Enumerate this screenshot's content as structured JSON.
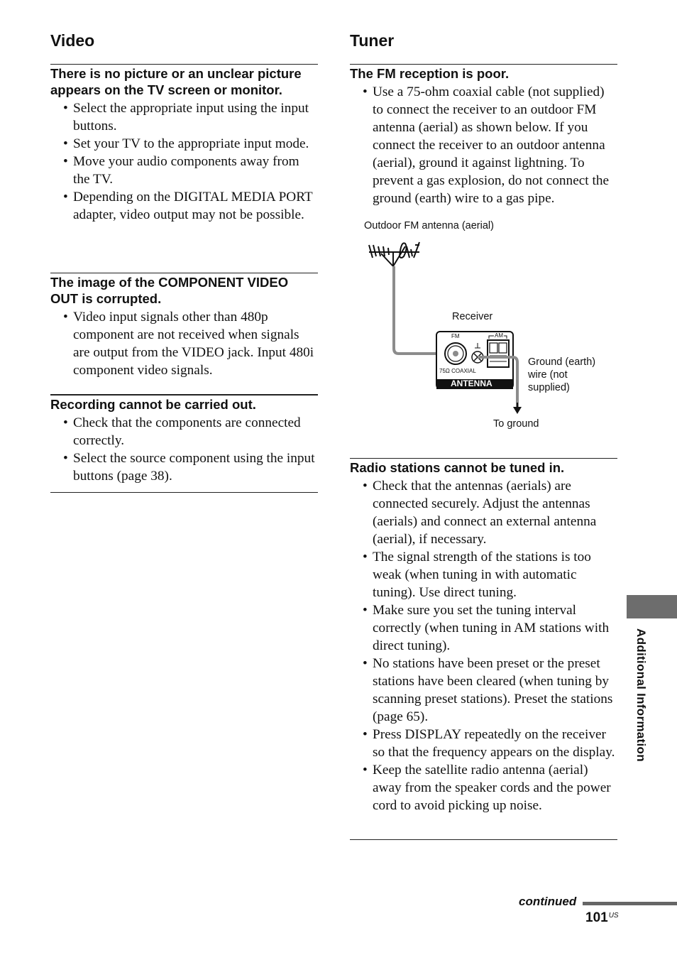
{
  "video": {
    "title": "Video",
    "problems": [
      {
        "heading": "There is no picture or an unclear picture appears on the TV screen or monitor.",
        "items": [
          "Select the appropriate input using the input buttons.",
          "Set your TV to the appropriate input mode.",
          "Move your audio components away from the TV.",
          "Depending on the DIGITAL MEDIA PORT adapter, video output may not be possible."
        ]
      },
      {
        "heading": "The image of the COMPONENT VIDEO OUT is corrupted.",
        "items": [
          "Video input signals other than 480p component are not received when signals are output from the VIDEO jack. Input 480i component video signals."
        ]
      },
      {
        "heading": "Recording cannot be carried out.",
        "items": [
          "Check that the components are connected correctly.",
          "Select the source component using the input buttons (page 38)."
        ]
      }
    ]
  },
  "tuner": {
    "title": "Tuner",
    "problems": [
      {
        "heading": "The FM reception is poor.",
        "items": [
          "Use a 75-ohm coaxial cable (not supplied) to connect the receiver to an outdoor FM antenna (aerial) as shown below. If you connect the receiver to an outdoor antenna (aerial), ground it against lightning. To prevent a gas explosion, do not connect the ground (earth) wire to a gas pipe."
        ]
      },
      {
        "heading": "Radio stations cannot be tuned in.",
        "items": [
          "Check that the antennas (aerials) are connected securely. Adjust the antennas (aerials) and connect an external antenna (aerial), if necessary.",
          "The signal strength of the stations is too weak (when tuning in with automatic tuning). Use direct tuning.",
          "Make sure you set the tuning interval correctly (when tuning in AM stations with direct tuning).",
          "No stations have been preset or the preset stations have been cleared (when tuning by scanning preset stations). Preset the stations (page 65).",
          "Press DISPLAY repeatedly on the receiver so that the frequency appears on the display.",
          "Keep the satellite radio antenna (aerial) away from the speaker cords and the power cord to avoid picking up noise."
        ]
      }
    ],
    "diagram": {
      "outdoor_antenna_label": "Outdoor FM antenna (aerial)",
      "receiver_label": "Receiver",
      "fm_label": "FM",
      "am_label": "AM",
      "coaxial_label": "75Ω COAXIAL",
      "antenna_label": "ANTENNA",
      "ground_wire_label_1": "Ground (earth)",
      "ground_wire_label_2": "wire (not",
      "ground_wire_label_3": "supplied)",
      "to_ground_label": "To ground"
    }
  },
  "side_tab": {
    "label": "Additional Information"
  },
  "footer": {
    "continued": "continued",
    "page_number": "101",
    "page_suffix": "US"
  }
}
